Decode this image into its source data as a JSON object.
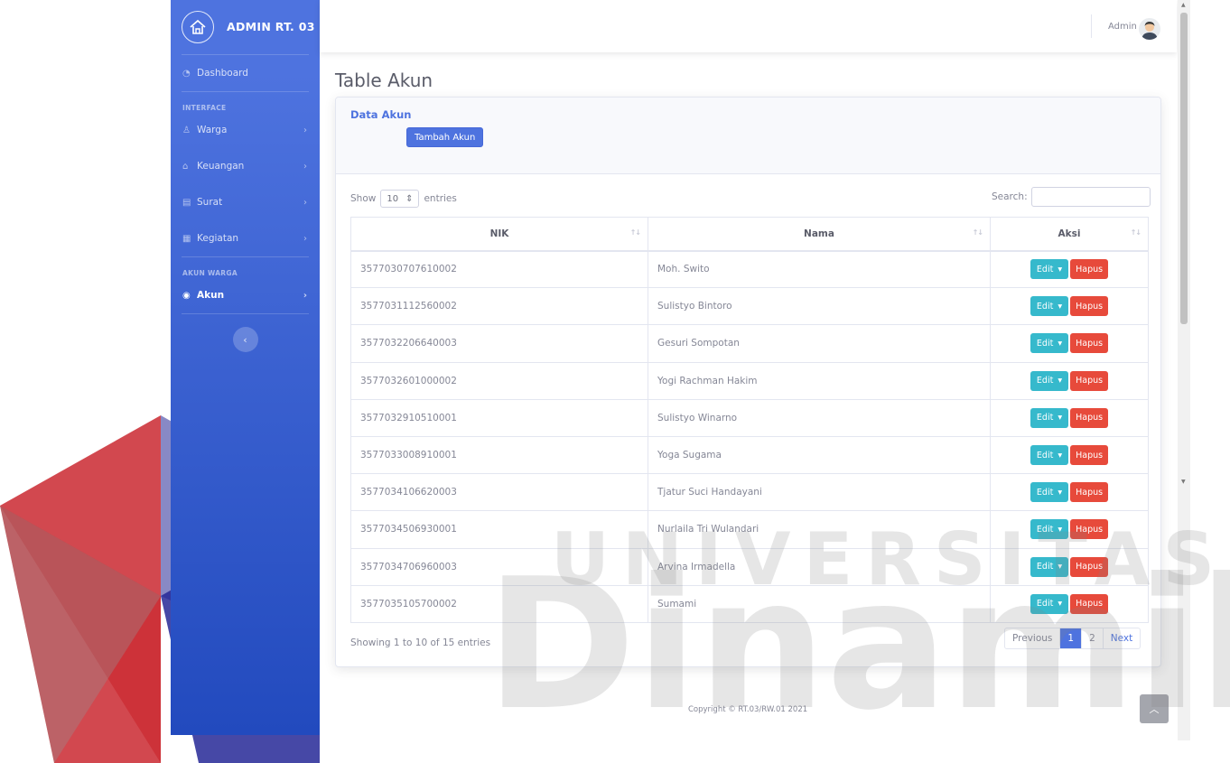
{
  "brand": {
    "name": "ADMIN RT. 03"
  },
  "sidebar": {
    "dashboard": "Dashboard",
    "heading_interface": "INTERFACE",
    "items": [
      {
        "label": "Warga",
        "icon": "user-icon"
      },
      {
        "label": "Keuangan",
        "icon": "bank-icon"
      },
      {
        "label": "Surat",
        "icon": "file-icon"
      },
      {
        "label": "Kegiatan",
        "icon": "calendar-icon"
      }
    ],
    "heading_akun": "AKUN WARGA",
    "akun": "Akun",
    "toggle": "‹"
  },
  "topbar": {
    "user": "Admin"
  },
  "page": {
    "title": "Table Akun"
  },
  "card": {
    "title": "Data Akun",
    "add_button": "Tambah Akun"
  },
  "datatable": {
    "show_label": "Show",
    "length_value": "10",
    "entries_label": "entries",
    "search_label": "Search:",
    "columns": [
      "NIK",
      "Nama",
      "Aksi"
    ],
    "rows": [
      {
        "nik": "3577030707610002",
        "nama": "Moh. Swito"
      },
      {
        "nik": "3577031112560002",
        "nama": "Sulistyo Bintoro"
      },
      {
        "nik": "3577032206640003",
        "nama": "Gesuri Sompotan"
      },
      {
        "nik": "3577032601000002",
        "nama": "Yogi Rachman Hakim"
      },
      {
        "nik": "3577032910510001",
        "nama": "Sulistyo Winarno"
      },
      {
        "nik": "3577033008910001",
        "nama": "Yoga Sugama"
      },
      {
        "nik": "3577034106620003",
        "nama": "Tjatur Suci Handayani"
      },
      {
        "nik": "3577034506930001",
        "nama": "Nurlaila Tri Wulandari"
      },
      {
        "nik": "3577034706960003",
        "nama": "Arvina Irmadella"
      },
      {
        "nik": "3577035105700002",
        "nama": "Sumami"
      }
    ],
    "edit_label": "Edit",
    "delete_label": "Hapus",
    "info": "Showing 1 to 10 of 15 entries",
    "pagination": {
      "previous": "Previous",
      "pages": [
        "1",
        "2"
      ],
      "current": "1",
      "next": "Next"
    }
  },
  "footer": {
    "copyright": "Copyright © RT.03/RW.01 2021"
  },
  "watermark": {
    "line1": "UNIVERSITAS",
    "line2": "Dinamika"
  },
  "colors": {
    "primary": "#4e73df",
    "info": "#36b9cc",
    "danger": "#e74a3b",
    "text": "#858796"
  }
}
